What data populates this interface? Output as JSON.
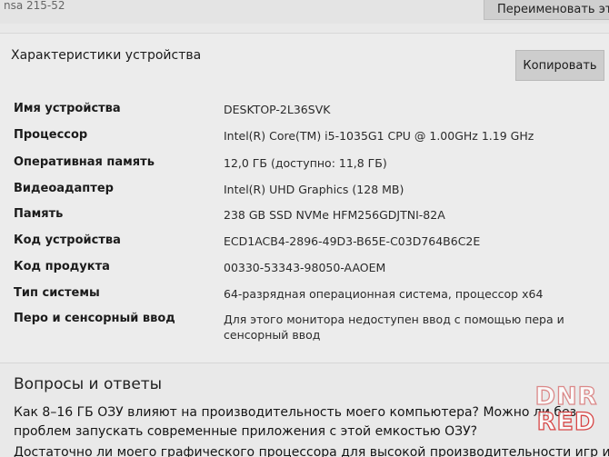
{
  "top": {
    "device_name_partial": "nsa 215-52",
    "rename_label": "Переименовать этот"
  },
  "specs": {
    "title": "Характеристики устройства",
    "copy_label": "Копировать",
    "rows": [
      {
        "label": "Имя устройства",
        "value": "DESKTOP-2L36SVK"
      },
      {
        "label": "Процессор",
        "value": "Intel(R) Core(TM) i5-1035G1 CPU @ 1.00GHz   1.19 GHz"
      },
      {
        "label": "Оперативная память",
        "value": "12,0 ГБ (доступно: 11,8 ГБ)"
      },
      {
        "label": "Видеоадаптер",
        "value": "Intel(R) UHD Graphics (128 MB)"
      },
      {
        "label": "Память",
        "value": "238 GB SSD NVMe HFM256GDJTNI-82A"
      },
      {
        "label": "Код устройства",
        "value": "ECD1ACB4-2896-49D3-B65E-C03D764B6C2E"
      },
      {
        "label": "Код продукта",
        "value": "00330-53343-98050-AAOEM"
      },
      {
        "label": "Тип системы",
        "value": "64-разрядная операционная система, процессор x64"
      },
      {
        "label": "Перо и сенсорный ввод",
        "value": "Для этого монитора недоступен ввод с помощью пера и сенсорный ввод"
      }
    ]
  },
  "qa": {
    "title": "Вопросы и ответы",
    "question_1": "Как 8–16 ГБ ОЗУ влияют на производительность моего компьютера? Можно ли без проблем запускать современные приложения с этой емкостью ОЗУ?",
    "question_2": "Достаточно ли моего графического процессора для высокой производительности игр и"
  },
  "watermark": {
    "line_1": "DNR",
    "line_2": "RED"
  }
}
